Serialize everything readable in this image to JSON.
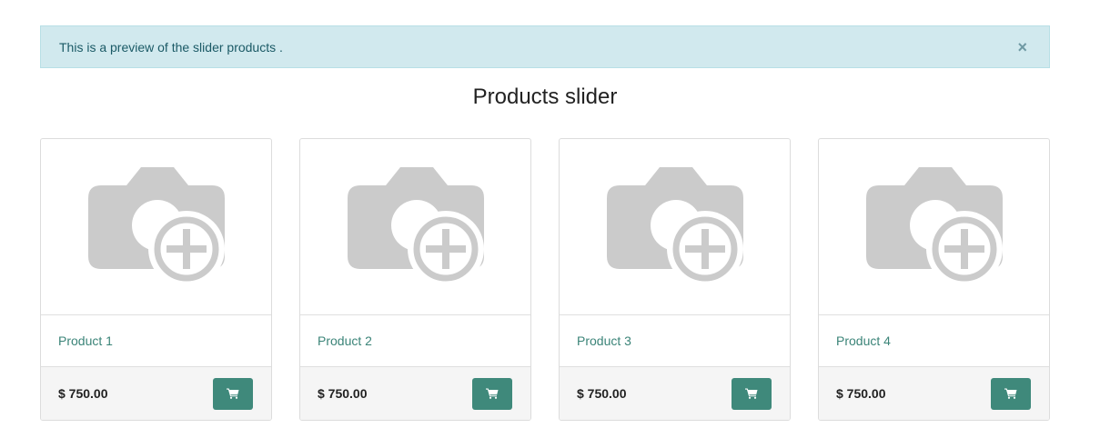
{
  "alert": {
    "message": "This is a preview of the slider products .",
    "close_glyph": "×"
  },
  "section": {
    "title": "Products slider"
  },
  "products": [
    {
      "name": "Product 1",
      "price": "$ 750.00",
      "image_icon": "camera-add-placeholder-icon",
      "cart_icon": "shopping-cart-icon"
    },
    {
      "name": "Product 2",
      "price": "$ 750.00",
      "image_icon": "camera-add-placeholder-icon",
      "cart_icon": "shopping-cart-icon"
    },
    {
      "name": "Product 3",
      "price": "$ 750.00",
      "image_icon": "camera-add-placeholder-icon",
      "cart_icon": "shopping-cart-icon"
    },
    {
      "name": "Product 4",
      "price": "$ 750.00",
      "image_icon": "camera-add-placeholder-icon",
      "cart_icon": "shopping-cart-icon"
    }
  ],
  "colors": {
    "alert_bg": "#d1e9ee",
    "link": "#3b8478",
    "cart_button": "#3f897b",
    "placeholder_icon": "#cbcbcb",
    "footer_bg": "#f5f5f5"
  }
}
